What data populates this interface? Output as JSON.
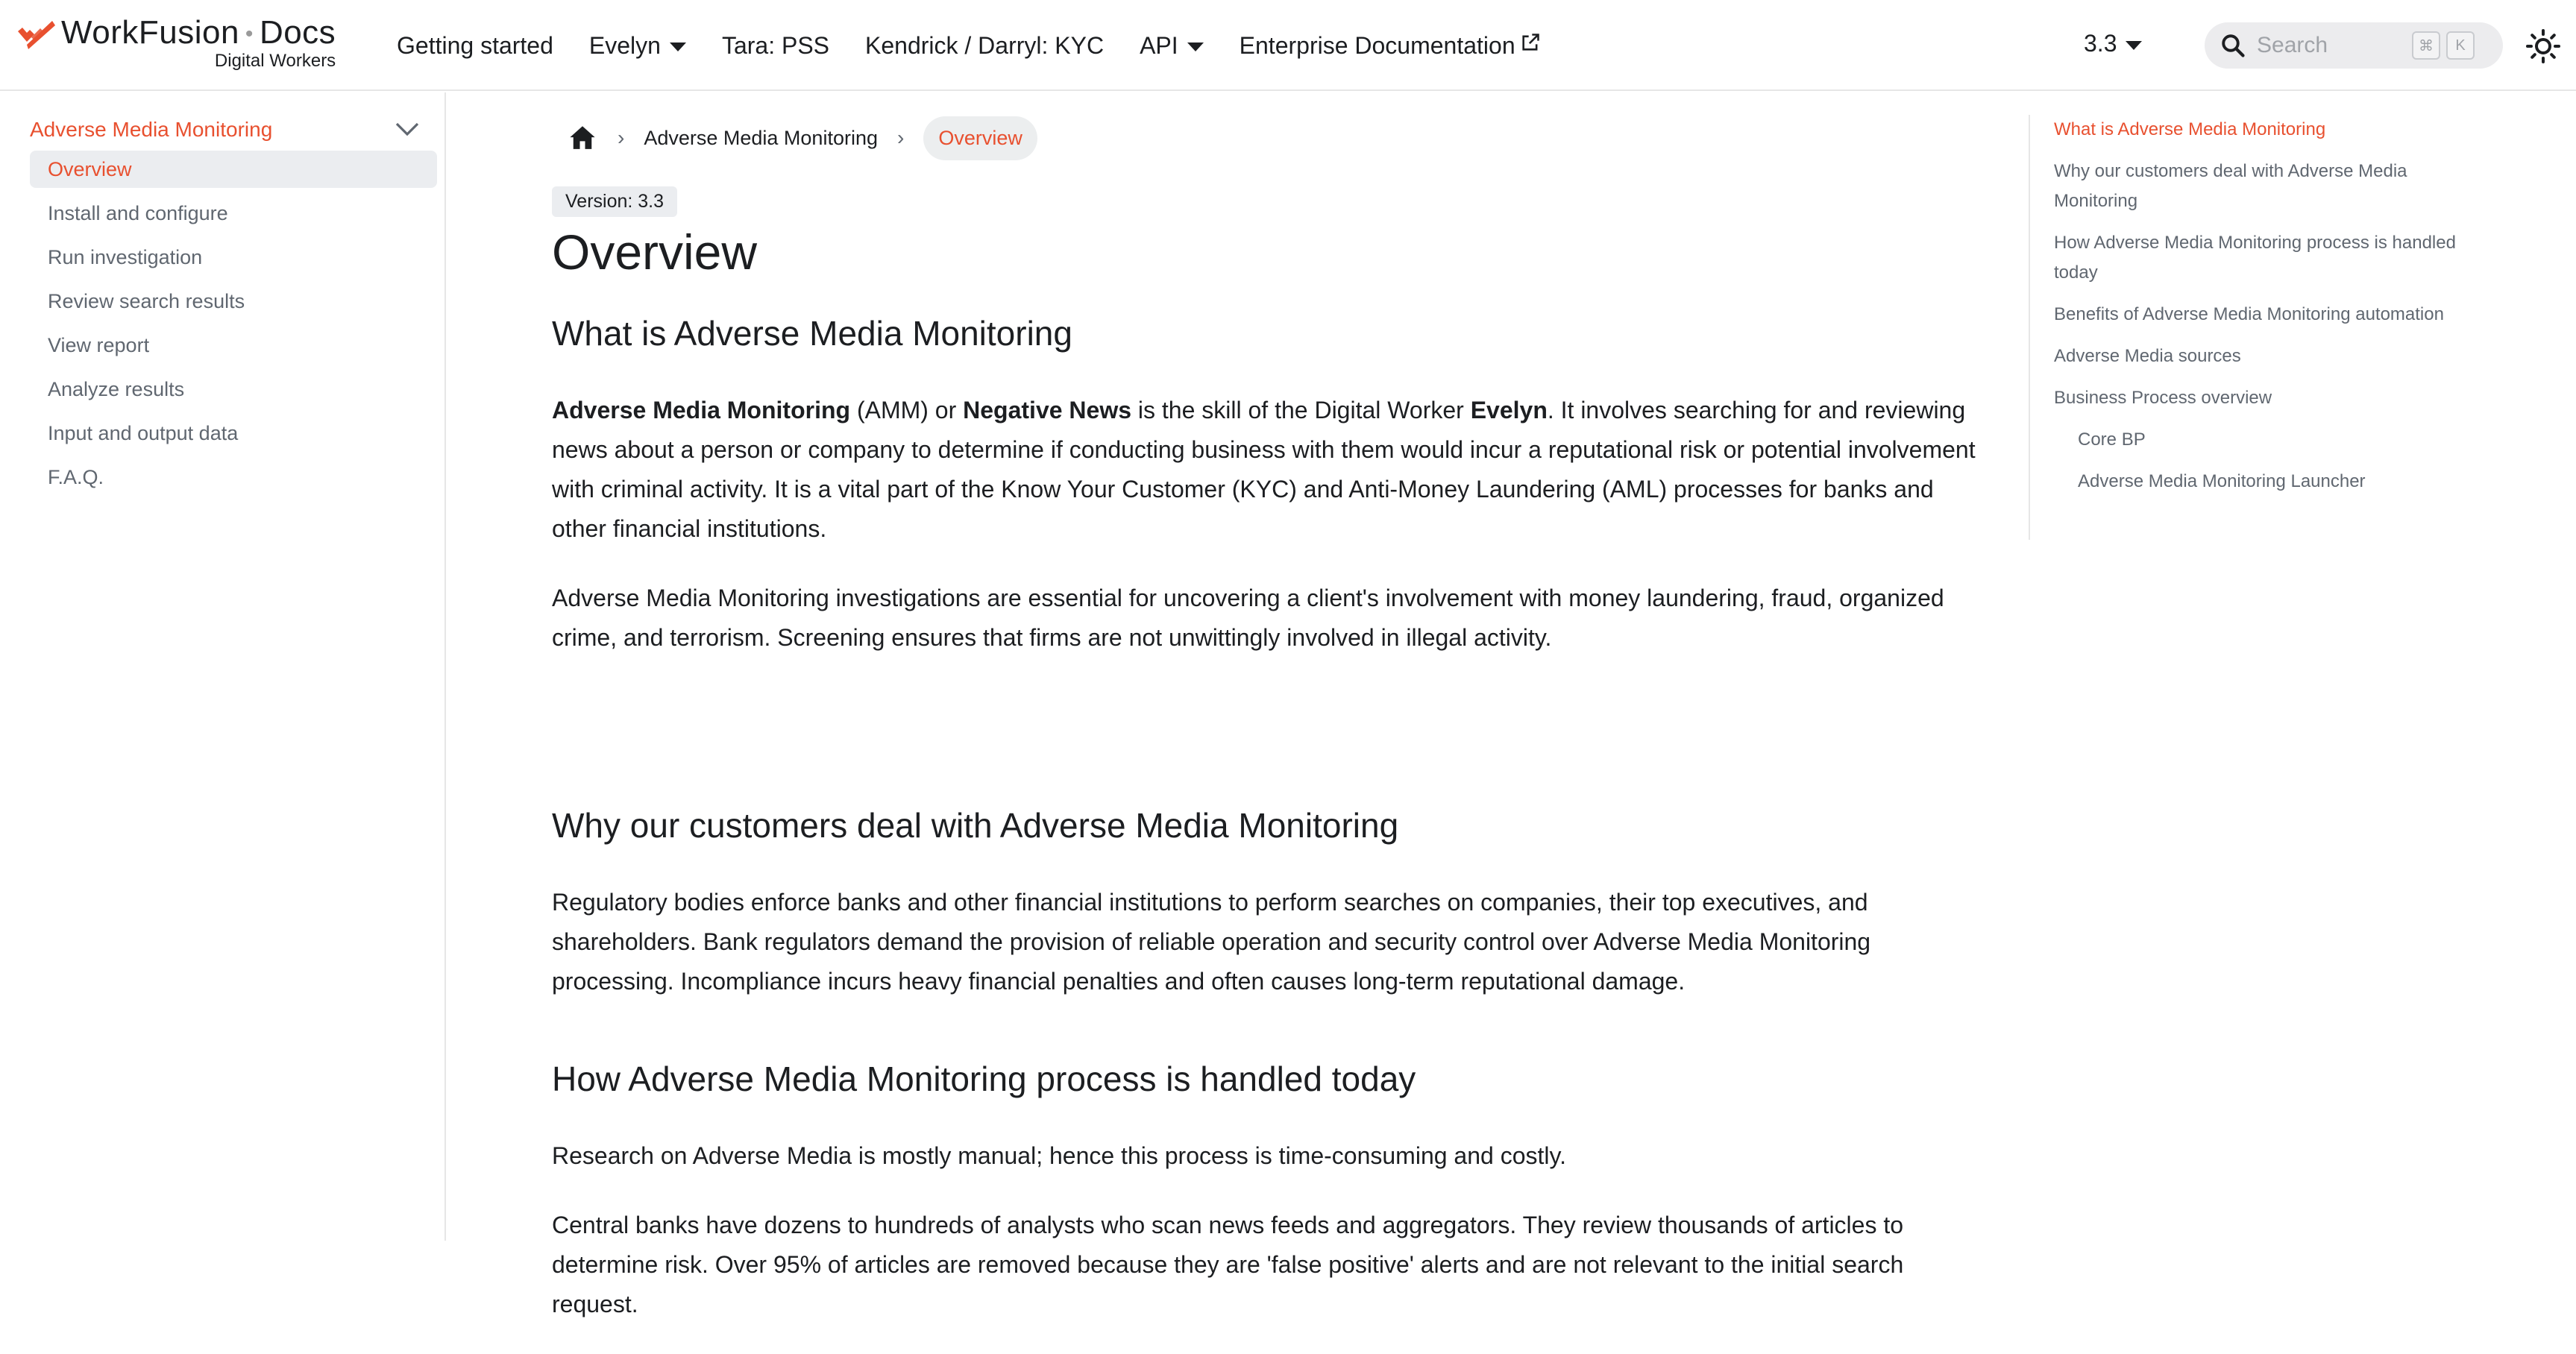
{
  "navbar": {
    "brand_title": "WorkFusion",
    "brand_title_suffix": "Docs",
    "brand_subtitle": "Digital Workers",
    "links": [
      {
        "label": "Getting started",
        "dropdown": false
      },
      {
        "label": "Evelyn",
        "dropdown": true
      },
      {
        "label": "Tara: PSS",
        "dropdown": false
      },
      {
        "label": "Kendrick / Darryl: KYC",
        "dropdown": false
      },
      {
        "label": "API",
        "dropdown": true
      },
      {
        "label": "Enterprise Documentation",
        "dropdown": false,
        "external": true
      }
    ],
    "version": "3.3",
    "search_placeholder": "Search",
    "search_key_1": "⌘",
    "search_key_2": "K"
  },
  "sidebar": {
    "category": "Adverse Media Monitoring",
    "items": [
      {
        "label": "Overview",
        "active": true
      },
      {
        "label": "Install and configure"
      },
      {
        "label": "Run investigation"
      },
      {
        "label": "Review search results"
      },
      {
        "label": "View report"
      },
      {
        "label": "Analyze results"
      },
      {
        "label": "Input and output data"
      },
      {
        "label": "F.A.Q."
      }
    ]
  },
  "breadcrumbs": {
    "parent": "Adverse Media Monitoring",
    "current": "Overview"
  },
  "page": {
    "version_badge": "Version: 3.3",
    "title": "Overview",
    "sections": [
      {
        "heading": "What is Adverse Media Monitoring",
        "p1_b1": "Adverse Media Monitoring",
        "p1_t1": " (AMM) or ",
        "p1_b2": "Negative News",
        "p1_t2": " is the skill of the Digital Worker ",
        "p1_b3": "Evelyn",
        "p1_t3": ". It involves searching for and reviewing news about a person or company to determine if conducting business with them would incur a reputational risk or potential involvement with criminal activity. It is a vital part of the Know Your Customer (KYC) and Anti-Money Laundering (AML) processes for banks and other financial institutions.",
        "p2": "Adverse Media Monitoring investigations are essential for uncovering a client's involvement with money laundering, fraud, organized crime, and terrorism. Screening ensures that firms are not unwittingly involved in illegal activity."
      },
      {
        "heading": "Why our customers deal with Adverse Media Monitoring",
        "p1": "Regulatory bodies enforce banks and other financial institutions to perform searches on companies, their top executives, and shareholders. Bank regulators demand the provision of reliable operation and security control over Adverse Media Monitoring processing. Incompliance incurs heavy financial penalties and often causes long-term reputational damage."
      },
      {
        "heading": "How Adverse Media Monitoring process is handled today",
        "p1": "Research on Adverse Media is mostly manual; hence this process is time-consuming and costly.",
        "p2": "Central banks have dozens to hundreds of analysts who scan news feeds and aggregators. They review thousands of articles to determine risk. Over 95% of articles are removed because they are 'false positive' alerts and are not relevant to the initial search request."
      }
    ]
  },
  "toc": [
    {
      "label": "What is Adverse Media Monitoring",
      "active": true
    },
    {
      "label": "Why our customers deal with Adverse Media Monitoring"
    },
    {
      "label": "How Adverse Media Monitoring process is handled today"
    },
    {
      "label": "Benefits of Adverse Media Monitoring automation"
    },
    {
      "label": "Adverse Media sources"
    },
    {
      "label": "Business Process overview"
    },
    {
      "label": "Core BP",
      "sub": true
    },
    {
      "label": "Adverse Media Monitoring Launcher",
      "sub": true
    }
  ],
  "colors": {
    "accent": "#e8502f",
    "text": "#1c1e21",
    "muted": "#606770",
    "active_bg": "#ebedf0"
  }
}
